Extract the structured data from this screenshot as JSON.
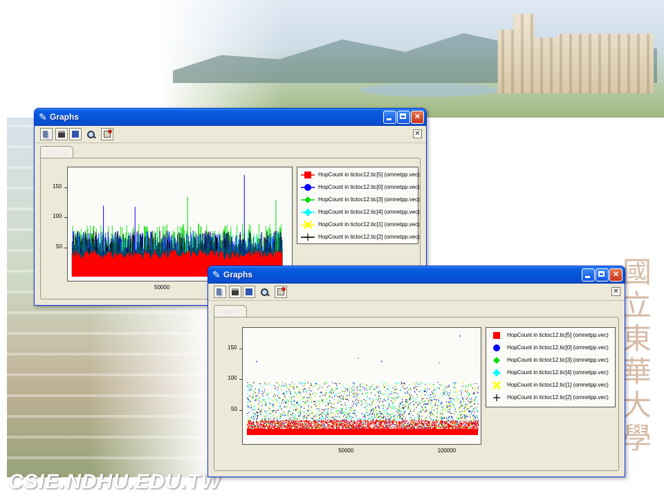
{
  "logo_text": "CSIE.NDHU.EDU.TW",
  "calligraphy": [
    "國",
    "立",
    "東",
    "華",
    "大",
    "學"
  ],
  "window1": {
    "title": "Graphs",
    "tab": "Chart 1",
    "toolbar": [
      "copy-icon",
      "save-icon",
      "save-ps-icon",
      "zoom-icon",
      "properties-icon"
    ],
    "close_mark": "✕"
  },
  "window2": {
    "title": "Graphs",
    "tab": "Chart 1",
    "toolbar": [
      "copy-icon",
      "save-icon",
      "save-ps-icon",
      "zoom-icon",
      "properties-icon"
    ],
    "close_mark": "✕"
  },
  "chart_data": [
    {
      "type": "bar",
      "style": "dense vector bars (one per sample)",
      "ylim": [
        0,
        180
      ],
      "xlim": [
        0,
        115000
      ],
      "y_ticks": [
        {
          "value": 50,
          "label": "50"
        },
        {
          "value": 100,
          "label": "100"
        },
        {
          "value": 150,
          "label": "150"
        }
      ],
      "x_ticks": [
        {
          "value": 50000,
          "label": "50000"
        }
      ],
      "legend_placement": "right",
      "grid": false,
      "series": [
        {
          "name": "HopCount in tictoc12.tic[5] (omnetpp.vec)",
          "color": "#ff0000",
          "marker": "square-line"
        },
        {
          "name": "HopCount in tictoc12.tic[0] (omnetpp.vec)",
          "color": "#0000ff",
          "marker": "circle-line"
        },
        {
          "name": "HopCount in tictoc12.tic[3] (omnetpp.vec)",
          "color": "#00dd00",
          "marker": "diamond-line"
        },
        {
          "name": "HopCount in tictoc12.tic[4] (omnetpp.vec)",
          "color": "#00ffff",
          "marker": "cross-line"
        },
        {
          "name": "HopCount in tictoc12.tic[1] (omnetpp.vec)",
          "color": "#ffff00",
          "marker": "x-line"
        },
        {
          "name": "HopCount in tictoc12.tic[2] (omnetpp.vec)",
          "color": "#000000",
          "marker": "plus-line"
        }
      ],
      "approx_levels": {
        "red_fill_top": 35,
        "typical_peak": 75,
        "max_peak": 172
      }
    },
    {
      "type": "scatter",
      "style": "dense dots",
      "ylim": [
        0,
        180
      ],
      "xlim": [
        0,
        115000
      ],
      "y_ticks": [
        {
          "value": 50,
          "label": "50"
        },
        {
          "value": 100,
          "label": "100"
        },
        {
          "value": 150,
          "label": "150"
        }
      ],
      "x_ticks": [
        {
          "value": 50000,
          "label": "50000"
        },
        {
          "value": 100000,
          "label": "100000"
        }
      ],
      "legend_placement": "right",
      "grid": false,
      "series": [
        {
          "name": "HopCount in tictoc12.tic[5] (omnetpp.vec)",
          "color": "#ff0000",
          "marker": "square"
        },
        {
          "name": "HopCount in tictoc12.tic[0] (omnetpp.vec)",
          "color": "#0000ff",
          "marker": "circle"
        },
        {
          "name": "HopCount in tictoc12.tic[3] (omnetpp.vec)",
          "color": "#00dd00",
          "marker": "diamond"
        },
        {
          "name": "HopCount in tictoc12.tic[4] (omnetpp.vec)",
          "color": "#00ffff",
          "marker": "cross"
        },
        {
          "name": "HopCount in tictoc12.tic[1] (omnetpp.vec)",
          "color": "#ffff00",
          "marker": "x"
        },
        {
          "name": "HopCount in tictoc12.tic[2] (omnetpp.vec)",
          "color": "#000000",
          "marker": "plus"
        }
      ],
      "approx_levels": {
        "dense_band_top": 35,
        "scatter_top": 90,
        "max_point": 172
      }
    }
  ]
}
